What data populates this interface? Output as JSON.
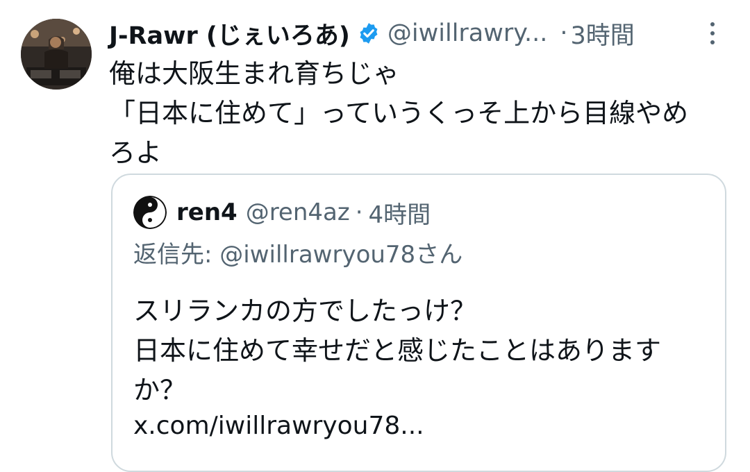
{
  "tweet": {
    "display_name": "J-Rawr (じぇいろあ)",
    "handle": "@iwillrawry...",
    "separator": "·",
    "time": "3時間",
    "text": "俺は大阪生まれ育ちじゃ\n「日本に住めて」っていうくっそ上から目線やめ\nろよ",
    "verified": true,
    "icons": {
      "avatar": "avatar-photo",
      "verified": "verified-badge-icon",
      "more": "more-options-icon"
    },
    "colors": {
      "verified": "#1d9bf0",
      "secondary_text": "#536471",
      "primary_text": "#0f1419",
      "border": "#cfd9de"
    }
  },
  "quote": {
    "display_name": "ren4",
    "handle": "@ren4az",
    "separator": "·",
    "time": "4時間",
    "reply_to": "返信先: @iwillrawryou78さん",
    "text": "スリランカの方でしたっけ？\n日本に住めて幸せだと感じたことはありますか？",
    "link": "x.com/iwillrawryou78..."
  }
}
